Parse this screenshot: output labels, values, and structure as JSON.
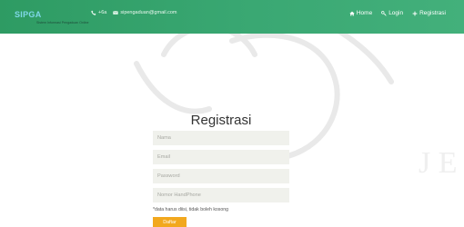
{
  "brand": {
    "logo_text": "SIPGA",
    "tagline": "Sistem Informasi Pengaduan Online"
  },
  "contact": {
    "phone": "+6a",
    "email": "sipengaduan@gmail.com"
  },
  "nav": {
    "home": "Home",
    "login": "Login",
    "register": "Registrasi"
  },
  "form": {
    "title": "Registrasi",
    "name_placeholder": "Nama",
    "email_placeholder": "Email",
    "password_placeholder": "Password",
    "phone_placeholder": "Nomor HandPhone",
    "note": "*data harus diisi, tidak boleh kosong",
    "submit": "Daftar"
  },
  "colors": {
    "navbar": "#3aa873",
    "button": "#f2a81e"
  }
}
